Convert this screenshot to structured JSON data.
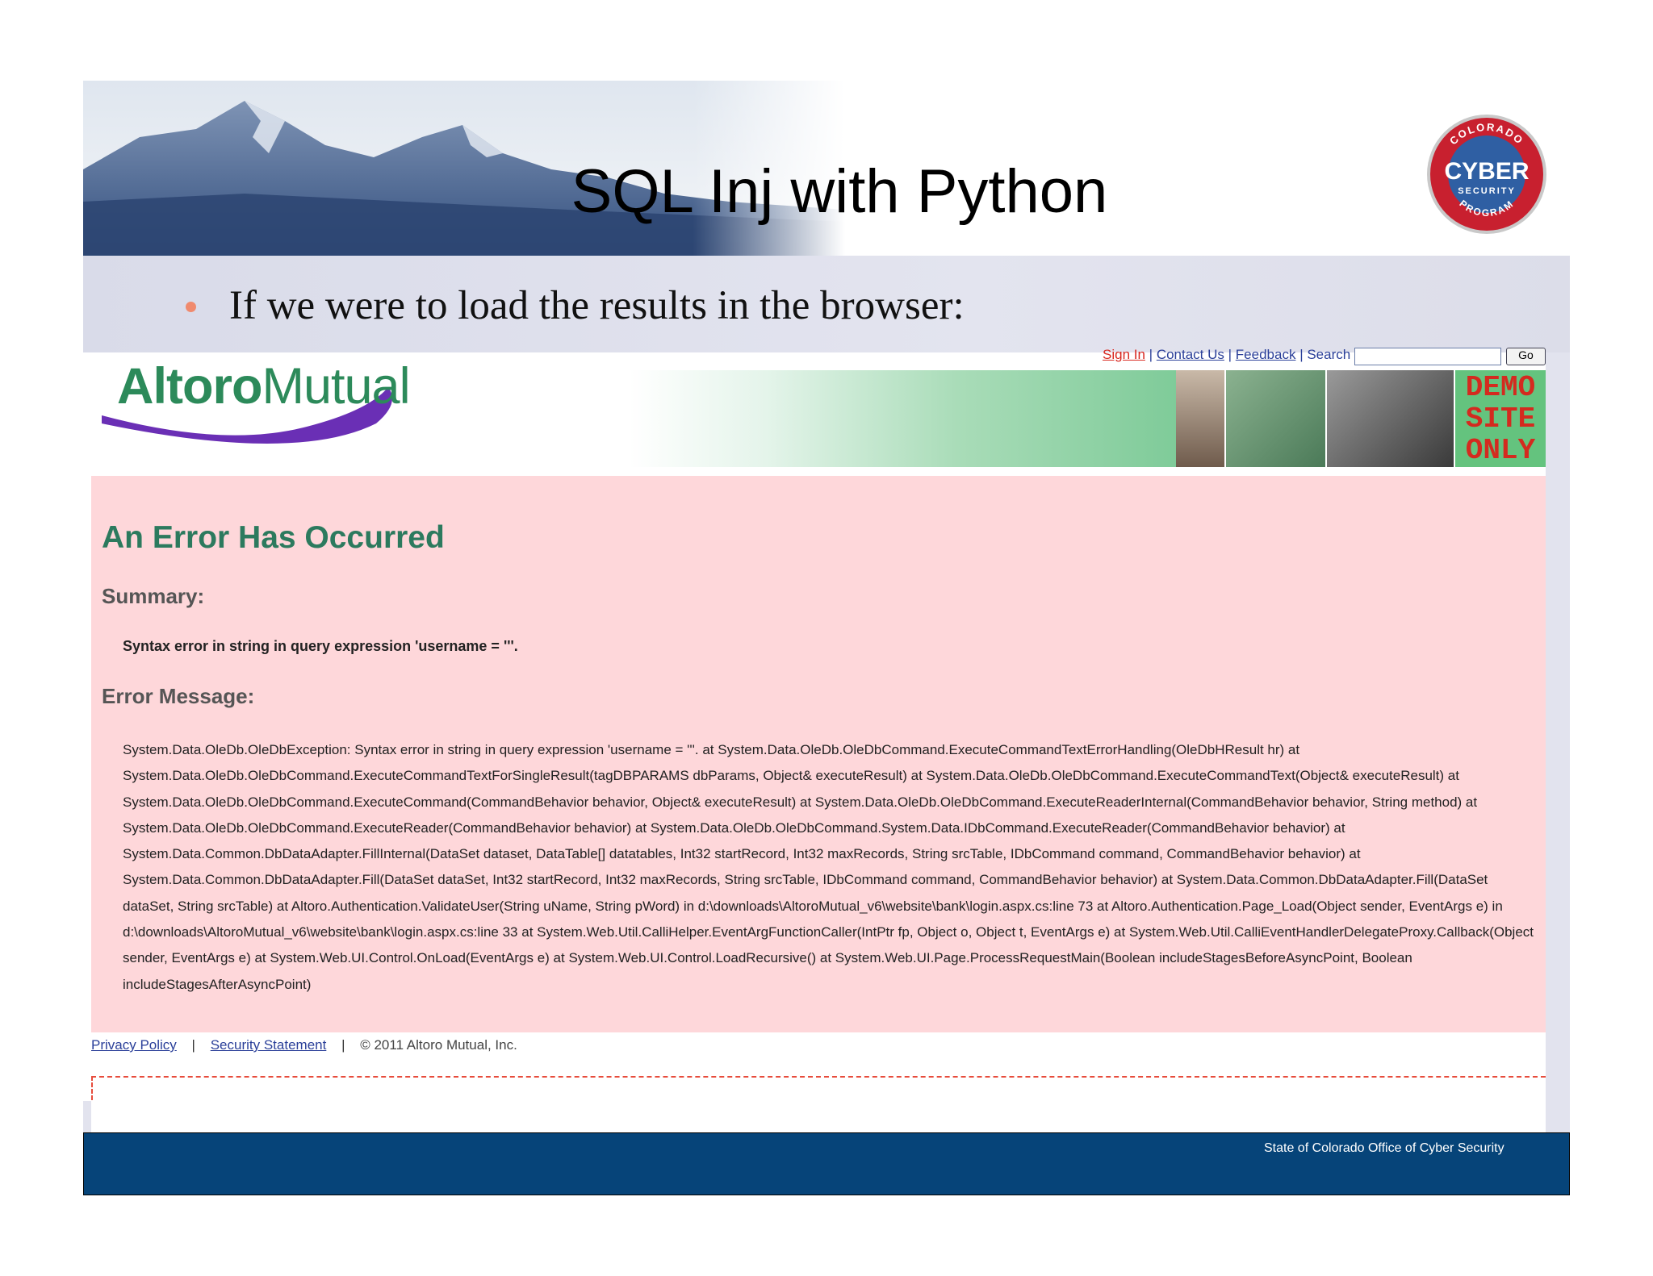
{
  "slide": {
    "title": "SQL Inj with Python",
    "bullet": "If we were to load the results in the browser:",
    "footer": "State of Colorado Office of Cyber Security",
    "badge": {
      "top_text": "COLORADO",
      "main_text": "CYBER",
      "sub_text": "SECURITY",
      "bottom_text": "PROGRAM"
    }
  },
  "browser": {
    "logo": {
      "bold": "Altoro",
      "light": "Mutual"
    },
    "nav": {
      "sign_in": "Sign In",
      "contact": "Contact Us",
      "feedback": "Feedback",
      "search_label": "Search",
      "go_label": "Go"
    },
    "demo_badge": [
      "DEMO",
      "SITE",
      "ONLY"
    ],
    "error": {
      "title": "An Error Has Occurred",
      "summary_heading": "Summary:",
      "summary_text": "Syntax error in string in query expression 'username = '''.",
      "message_heading": "Error Message:",
      "message_text": "System.Data.OleDb.OleDbException: Syntax error in string in query expression 'username = '''. at System.Data.OleDb.OleDbCommand.ExecuteCommandTextErrorHandling(OleDbHResult hr) at System.Data.OleDb.OleDbCommand.ExecuteCommandTextForSingleResult(tagDBPARAMS dbParams, Object& executeResult) at System.Data.OleDb.OleDbCommand.ExecuteCommandText(Object& executeResult) at System.Data.OleDb.OleDbCommand.ExecuteCommand(CommandBehavior behavior, Object& executeResult) at System.Data.OleDb.OleDbCommand.ExecuteReaderInternal(CommandBehavior behavior, String method) at System.Data.OleDb.OleDbCommand.ExecuteReader(CommandBehavior behavior) at System.Data.OleDb.OleDbCommand.System.Data.IDbCommand.ExecuteReader(CommandBehavior behavior) at System.Data.Common.DbDataAdapter.FillInternal(DataSet dataset, DataTable[] datatables, Int32 startRecord, Int32 maxRecords, String srcTable, IDbCommand command, CommandBehavior behavior) at System.Data.Common.DbDataAdapter.Fill(DataSet dataSet, Int32 startRecord, Int32 maxRecords, String srcTable, IDbCommand command, CommandBehavior behavior) at System.Data.Common.DbDataAdapter.Fill(DataSet dataSet, String srcTable) at Altoro.Authentication.ValidateUser(String uName, String pWord) in d:\\downloads\\AltoroMutual_v6\\website\\bank\\login.aspx.cs:line 73 at Altoro.Authentication.Page_Load(Object sender, EventArgs e) in d:\\downloads\\AltoroMutual_v6\\website\\bank\\login.aspx.cs:line 33 at System.Web.Util.CalliHelper.EventArgFunctionCaller(IntPtr fp, Object o, Object t, EventArgs e) at System.Web.Util.CalliEventHandlerDelegateProxy.Callback(Object sender, EventArgs e) at System.Web.UI.Control.OnLoad(EventArgs e) at System.Web.UI.Control.LoadRecursive() at System.Web.UI.Page.ProcessRequestMain(Boolean includeStagesBeforeAsyncPoint, Boolean includeStagesAfterAsyncPoint)"
    },
    "footer": {
      "privacy": "Privacy Policy",
      "security": "Security Statement",
      "copyright": "© 2011 Altoro Mutual, Inc."
    }
  },
  "colors": {
    "error_panel": "#fed7da",
    "error_title": "#2c7a5e",
    "bottom_bar": "#064479",
    "bullet": "#f08a6e",
    "demo_text": "#d42a1f"
  }
}
